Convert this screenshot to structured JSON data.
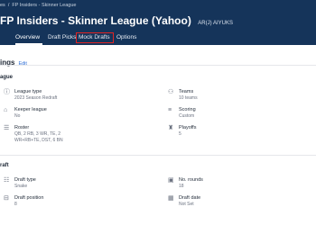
{
  "header": {
    "breadcrumb": {
      "parent": "es",
      "separator": "/",
      "current": "FP Insiders - Skinner League"
    },
    "title": "FP Insiders - Skinner League (Yahoo)",
    "tag": "AR(J) AIYUKS"
  },
  "tabs": [
    {
      "label": "Overview",
      "active": true
    },
    {
      "label": "Draft Picks",
      "active": false
    },
    {
      "label": "Mock Drafts",
      "active": false,
      "highlighted": true
    },
    {
      "label": "Options",
      "active": false
    }
  ],
  "settings": {
    "title": "ings",
    "edit_label": "Edit",
    "league": {
      "label": "ague",
      "items": [
        {
          "label": "League type",
          "value": "2023 Season Redraft",
          "icon": "info-icon"
        },
        {
          "label": "Teams",
          "value": "10 teams",
          "icon": "team-icon"
        },
        {
          "label": "Keeper league",
          "value": "No",
          "icon": "tag-icon"
        },
        {
          "label": "Scoring",
          "value": "Custom",
          "icon": "scoring-icon"
        },
        {
          "label": "Roster",
          "value": "QB, 2 RB, 3 WR, TE, 2",
          "value2": "WR+RB+TE, DST, 6 BN",
          "icon": "roster-icon"
        },
        {
          "label": "Playoffs",
          "value": "5",
          "icon": "trophy-icon"
        }
      ]
    },
    "draft": {
      "label": "raft",
      "items": [
        {
          "label": "Draft type",
          "value": "Snake",
          "icon": "draft-type-icon"
        },
        {
          "label": "No. rounds",
          "value": "18",
          "icon": "rounds-icon"
        },
        {
          "label": "Draft position",
          "value": "8",
          "icon": "position-icon"
        },
        {
          "label": "Draft date",
          "value": "Not Set",
          "icon": "calendar-icon"
        }
      ]
    }
  },
  "colors": {
    "header": "#15345a",
    "highlight": "#e02424",
    "link": "#2f6fd6"
  }
}
